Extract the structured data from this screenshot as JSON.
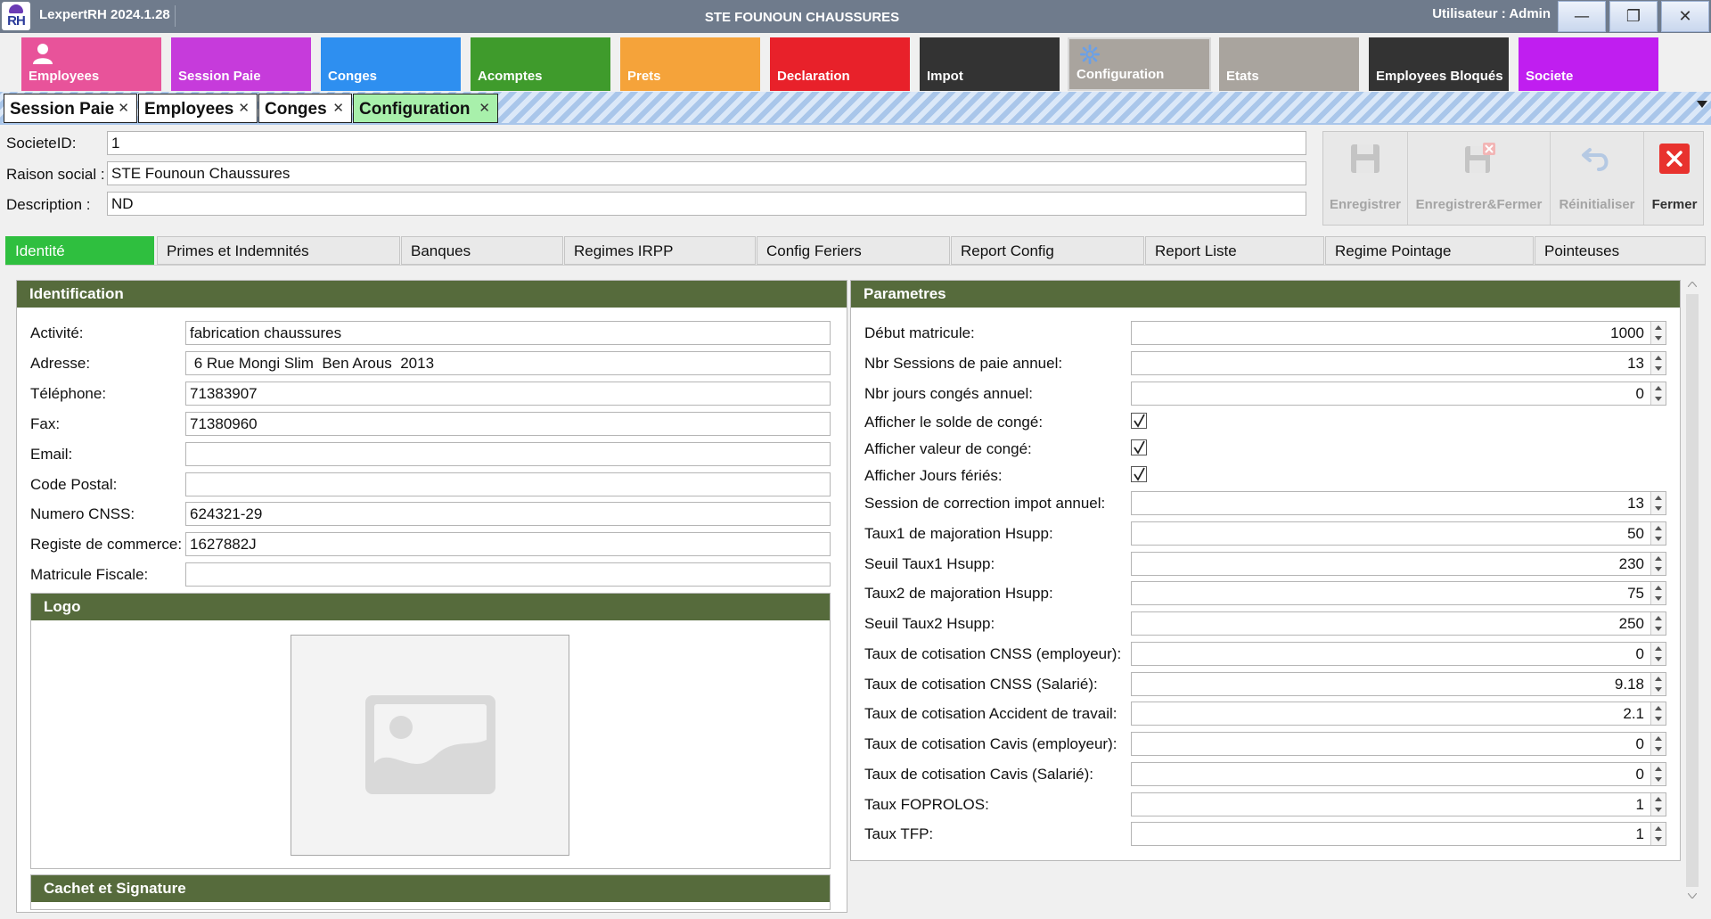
{
  "app": {
    "title": "LexpertRH 2024.1.28",
    "window_title": "STE FOUNOUN CHAUSSURES",
    "user": "Utilisateur : Admin",
    "logo_text": "RH"
  },
  "window_controls": {
    "minimize": "—",
    "restore": "❐",
    "close": "✕"
  },
  "modules": [
    {
      "label": "Employees",
      "color": "#e8539a"
    },
    {
      "label": "Session Paie",
      "color": "#c63bdb"
    },
    {
      "label": "Conges",
      "color": "#2e8ff0"
    },
    {
      "label": "Acomptes",
      "color": "#3f9b2c"
    },
    {
      "label": "Prets",
      "color": "#f5a33a"
    },
    {
      "label": "Declaration",
      "color": "#e8212a"
    },
    {
      "label": "Impot",
      "color": "#333333"
    },
    {
      "label": "Configuration",
      "color": "#a9a49e"
    },
    {
      "label": "Etats",
      "color": "#a9a49e"
    },
    {
      "label": "Employees Bloqués",
      "color": "#333333"
    },
    {
      "label": "Societe",
      "color": "#c01ef0"
    }
  ],
  "doc_tabs": [
    {
      "label": "Session Paie",
      "close": "✕"
    },
    {
      "label": "Employees",
      "close": "✕"
    },
    {
      "label": "Conges",
      "close": "✕"
    },
    {
      "label": "Configuration",
      "close": "✕"
    }
  ],
  "header": {
    "societe_id": {
      "label": "SocieteID:",
      "value": "1"
    },
    "raison_social": {
      "label": "Raison social :",
      "value": "STE Founoun Chaussures"
    },
    "description": {
      "label": "Description :",
      "value": "ND"
    }
  },
  "toolbar": {
    "enregistrer": "Enregistrer",
    "enregistrer_fermer": "Enregistrer&Fermer",
    "reinitialiser": "Réinitialiser",
    "fermer": "Fermer"
  },
  "section_tabs": [
    "Identité",
    "Primes et Indemnités",
    "Banques",
    "Regimes IRPP",
    "Config Feriers",
    "Report Config",
    "Report Liste",
    "Regime Pointage",
    "Pointeuses"
  ],
  "identification": {
    "title": "Identification",
    "fields": [
      {
        "label": "Activité:",
        "value": "fabrication chaussures"
      },
      {
        "label": "Adresse:",
        "value": " 6 Rue Mongi Slim  Ben Arous  2013"
      },
      {
        "label": "Téléphone:",
        "value": "71383907"
      },
      {
        "label": "Fax:",
        "value": "71380960"
      },
      {
        "label": "Email:",
        "value": ""
      },
      {
        "label": "Code Postal:",
        "value": ""
      },
      {
        "label": "Numero CNSS:",
        "value": "624321-29"
      },
      {
        "label": "Registe de commerce:",
        "value": "1627882J"
      },
      {
        "label": "Matricule Fiscale:",
        "value": ""
      }
    ],
    "logo_title": "Logo",
    "cachet_title": "Cachet et Signature"
  },
  "parametres": {
    "title": "Parametres",
    "rows": [
      {
        "label": "Début matricule:",
        "type": "number",
        "value": "1000"
      },
      {
        "label": "Nbr Sessions de paie annuel:",
        "type": "number",
        "value": "13"
      },
      {
        "label": "Nbr jours congés annuel:",
        "type": "number",
        "value": "0"
      },
      {
        "label": "Afficher le solde de congé:",
        "type": "check",
        "checked": true
      },
      {
        "label": "Afficher valeur de congé:",
        "type": "check",
        "checked": true
      },
      {
        "label": "Afficher Jours fériés:",
        "type": "check",
        "checked": true
      },
      {
        "label": "Session de correction impot annuel:",
        "type": "number",
        "value": "13"
      },
      {
        "label": "Taux1 de majoration Hsupp:",
        "type": "number",
        "value": "50"
      },
      {
        "label": "Seuil Taux1 Hsupp:",
        "type": "number",
        "value": "230"
      },
      {
        "label": "Taux2 de majoration Hsupp:",
        "type": "number",
        "value": "75"
      },
      {
        "label": "Seuil Taux2 Hsupp:",
        "type": "number",
        "value": "250"
      },
      {
        "label": "Taux de cotisation CNSS (employeur):",
        "type": "number",
        "value": "0"
      },
      {
        "label": "Taux de cotisation CNSS (Salarié):",
        "type": "number",
        "value": "9.18"
      },
      {
        "label": "Taux de cotisation Accident de travail:",
        "type": "number",
        "value": "2.1"
      },
      {
        "label": "Taux de cotisation Cavis (employeur):",
        "type": "number",
        "value": "0"
      },
      {
        "label": "Taux de cotisation Cavis (Salarié):",
        "type": "number",
        "value": "0"
      },
      {
        "label": "Taux FOPROLOS:",
        "type": "number",
        "value": "1"
      },
      {
        "label": "Taux TFP:",
        "type": "number",
        "value": "1"
      }
    ]
  },
  "colors": {
    "title_bar": "#6f7b8c",
    "panel_header": "#566b3c",
    "active_tab": "#2fbf3f",
    "active_doc_tab": "#a8f0ab"
  },
  "icons": [
    "user-icon",
    "gear-icon",
    "save-icon",
    "save-close-icon",
    "undo-icon",
    "close-icon",
    "image-placeholder-icon",
    "checkmark-icon",
    "chevron-down-icon"
  ]
}
